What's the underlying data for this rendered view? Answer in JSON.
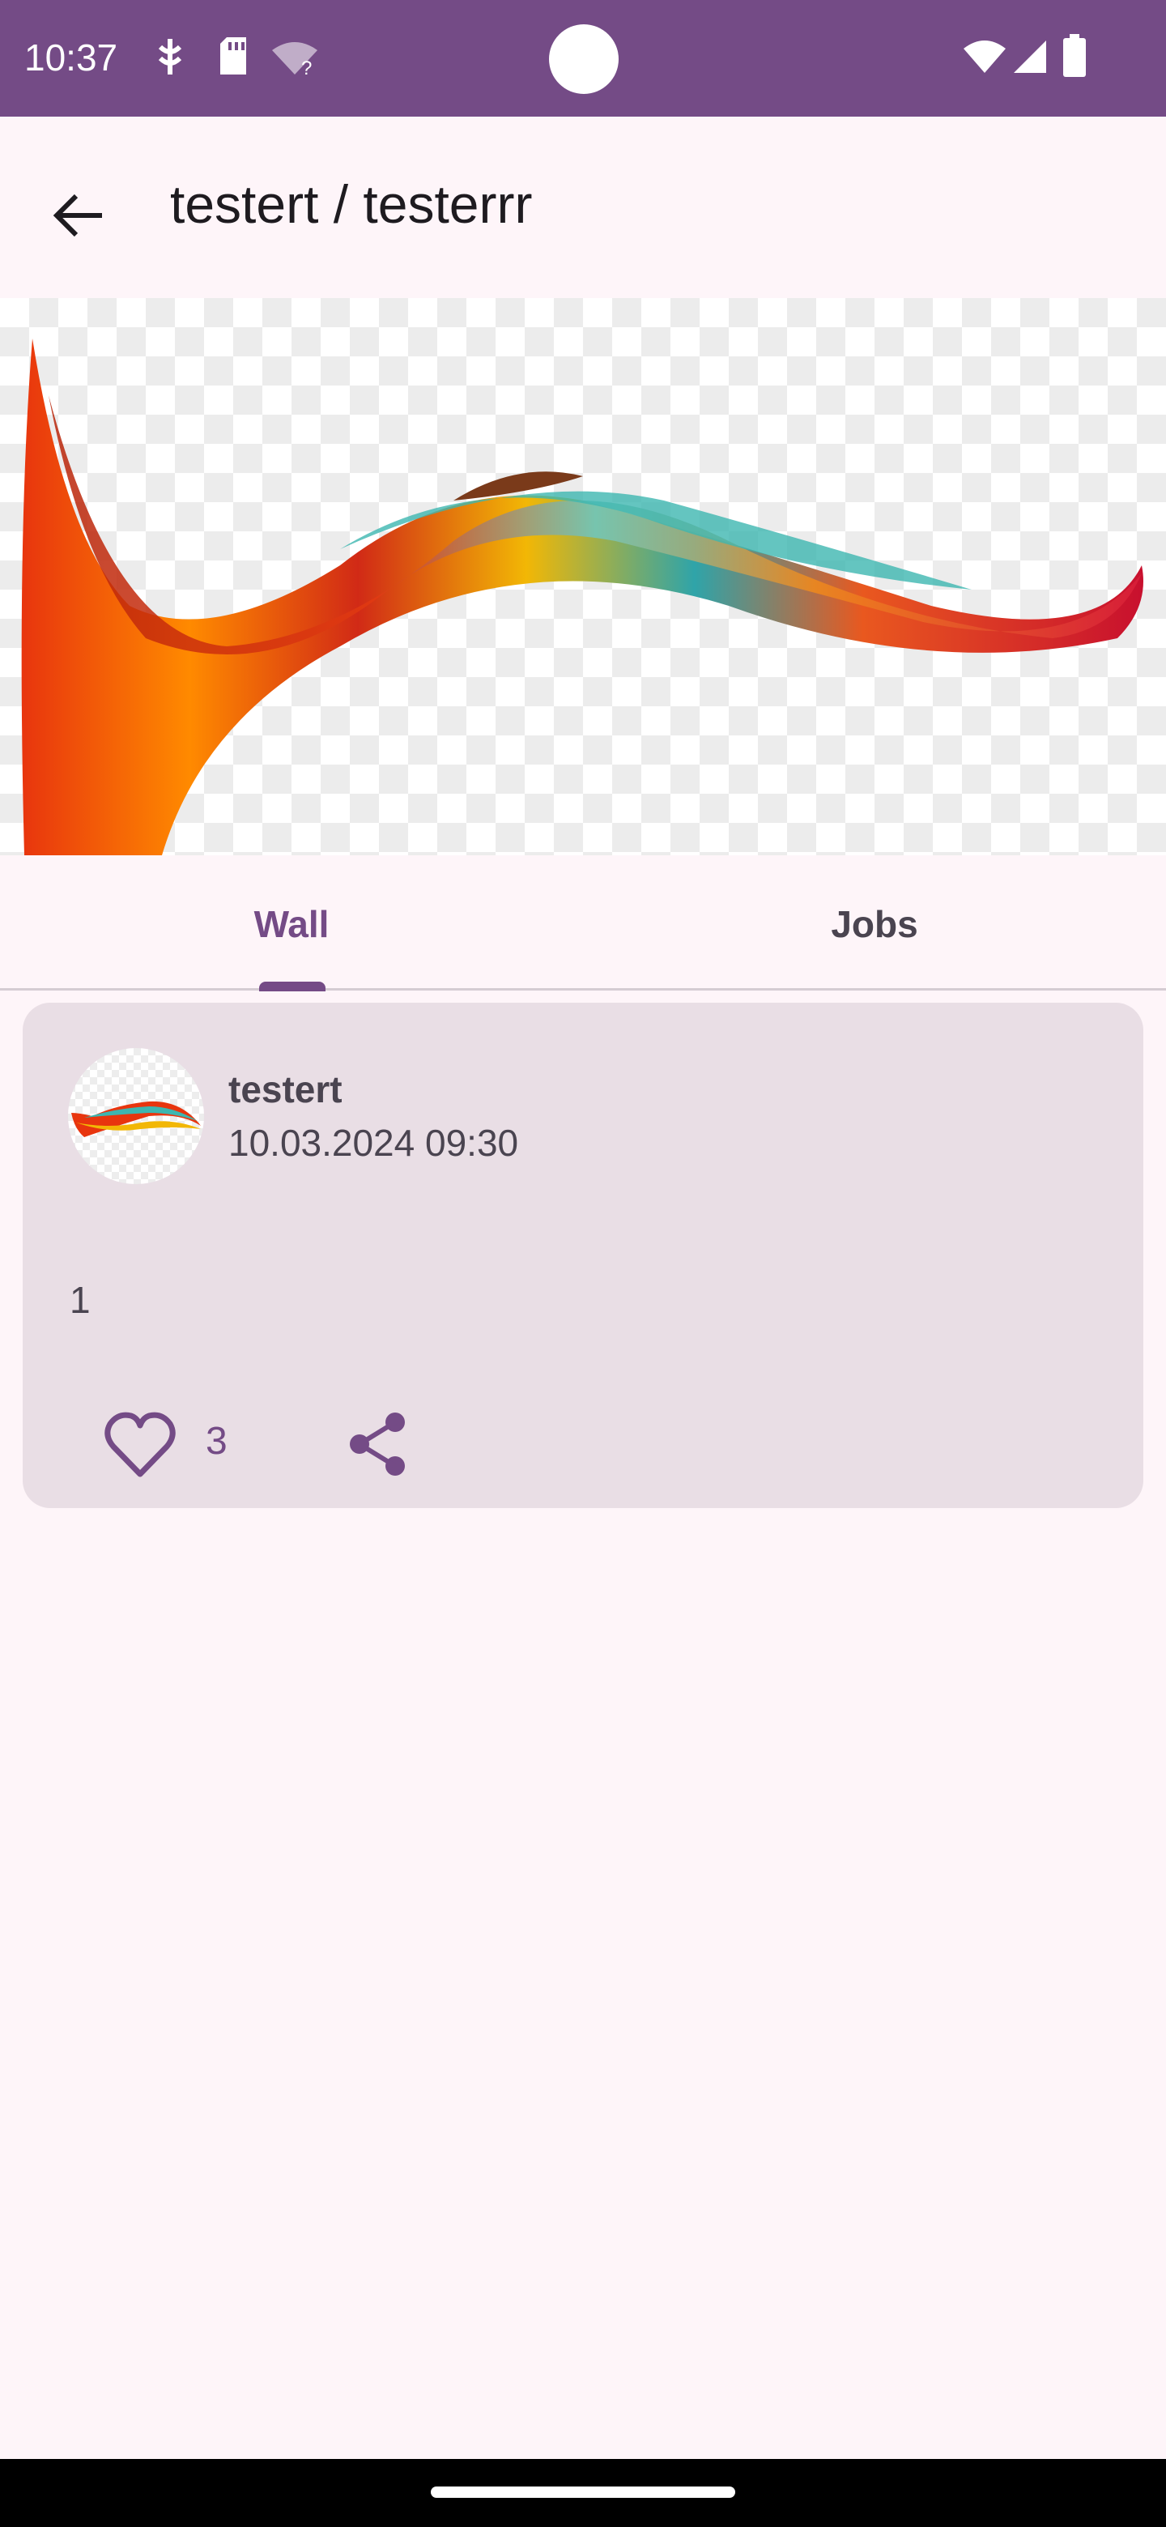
{
  "status_bar": {
    "time": "10:37",
    "left_icons": [
      "usb-debug-icon",
      "sd-card-icon",
      "wifi-question-icon"
    ],
    "right_icons": [
      "wifi-icon",
      "signal-icon",
      "battery-icon"
    ],
    "bg_color": "#744B86"
  },
  "app_bar": {
    "title": "testert / testerrr",
    "back_icon": "arrow-back-icon"
  },
  "banner": {
    "image": "colorful-wave-image"
  },
  "tabs": [
    {
      "label": "Wall",
      "selected": true
    },
    {
      "label": "Jobs",
      "selected": false
    }
  ],
  "post": {
    "author": "testert",
    "date": "10.03.2024 09:30",
    "content": "1",
    "likes": "3",
    "like_icon": "heart-outline-icon",
    "share_icon": "share-icon"
  },
  "colors": {
    "accent": "#744B86",
    "background": "#FEF5F9",
    "card": "#E9DEE5",
    "text": "#4A4450"
  }
}
